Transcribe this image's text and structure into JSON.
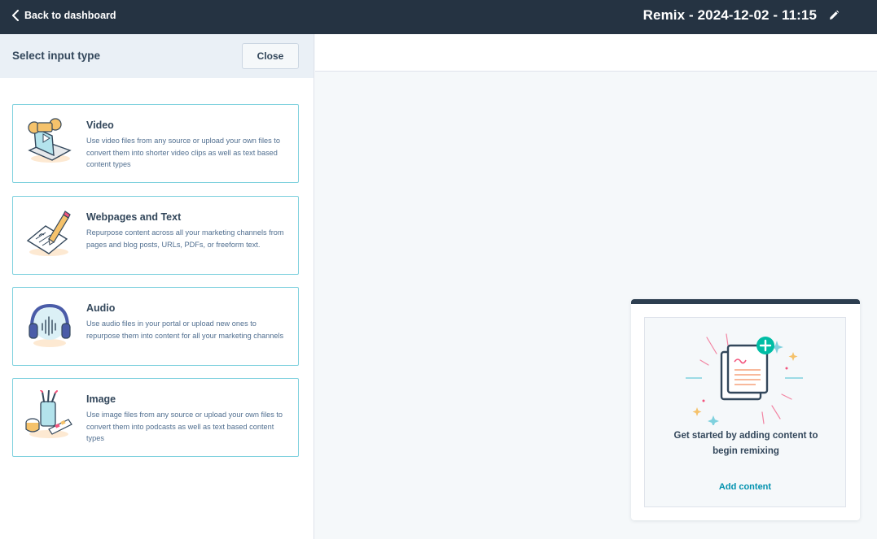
{
  "topbar": {
    "back_label": "Back to dashboard",
    "title": "Remix - 2024-12-02 - 11:15"
  },
  "panel": {
    "title": "Select input type",
    "close_label": "Close",
    "cards": [
      {
        "title": "Video",
        "description": "Use video files from any source or upload your own files to convert them into shorter video clips as well as text based content types",
        "icon": "laptop-video-icon"
      },
      {
        "title": "Webpages and Text",
        "description": "Repurpose content across all your marketing channels from pages and blog posts, URLs, PDFs, or freeform text.",
        "icon": "paper-pencil-icon"
      },
      {
        "title": "Audio",
        "description": "Use audio files in your portal or upload new ones to repurpose them into content for all your marketing channels",
        "icon": "headphones-icon"
      },
      {
        "title": "Image",
        "description": "Use image files from any source or upload your own files to convert them into podcasts as well as text based content types",
        "icon": "paint-supplies-icon"
      }
    ]
  },
  "empty_state": {
    "message": "Get started by adding content to begin remixing",
    "action_label": "Add content",
    "icon": "documents-plus-icon"
  },
  "colors": {
    "topbar": "#253342",
    "accent": "#0091ae",
    "card_border": "#7fd1de",
    "panel_header": "#eaf0f6"
  }
}
